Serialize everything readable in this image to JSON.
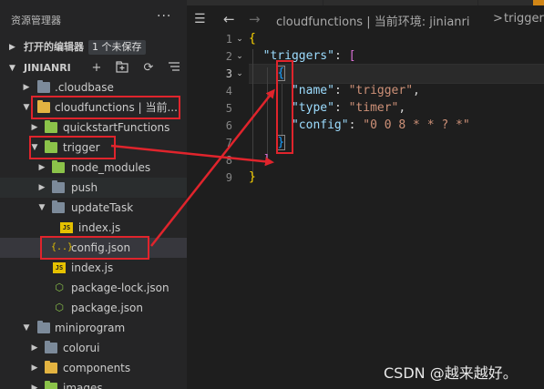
{
  "explorer": {
    "title": "资源管理器",
    "more": "···",
    "open_editors": {
      "label": "打开的编辑器",
      "badge": "1 个未保存"
    },
    "project": {
      "label": "JINIANRI"
    }
  },
  "tree": [
    {
      "label": ".cloudbase"
    },
    {
      "label": "cloudfunctions | 当前..."
    },
    {
      "label": "quickstartFunctions"
    },
    {
      "label": "trigger"
    },
    {
      "label": "node_modules"
    },
    {
      "label": "push"
    },
    {
      "label": "updateTask"
    },
    {
      "label": "index.js"
    },
    {
      "label": "config.json"
    },
    {
      "label": "index.js"
    },
    {
      "label": "package-lock.json"
    },
    {
      "label": "package.json"
    },
    {
      "label": "miniprogram"
    },
    {
      "label": "colorui"
    },
    {
      "label": "components"
    },
    {
      "label": "images"
    }
  ],
  "breadcrumb": {
    "segment1": "cloudfunctions | 当前环境: jinianri",
    "separator": ">",
    "segment2": "trigger"
  },
  "gutter": [
    "1",
    "2",
    "3",
    "4",
    "5",
    "6",
    "7",
    "8",
    "9"
  ],
  "code": {
    "l1_open": "{",
    "l2_key": "\"triggers\"",
    "l2_colon": ": ",
    "l2_open": "[",
    "l3_open": "{",
    "l4_key": "\"name\"",
    "l4_colon": ": ",
    "l4_val": "\"trigger\"",
    "l4_comma": ",",
    "l5_key": "\"type\"",
    "l5_colon": ": ",
    "l5_val": "\"timer\"",
    "l5_comma": ",",
    "l6_key": "\"config\"",
    "l6_colon": ": ",
    "l6_val": "\"0 0 8 * * ? *\"",
    "l7_close": "}",
    "l8_close": "]",
    "l9_close": "}"
  },
  "watermark": "CSDN @越来越好。",
  "colors": {
    "annotation_red": "#e0242c",
    "json_icon": "#e5c100",
    "node_green": "#8bc34a"
  }
}
